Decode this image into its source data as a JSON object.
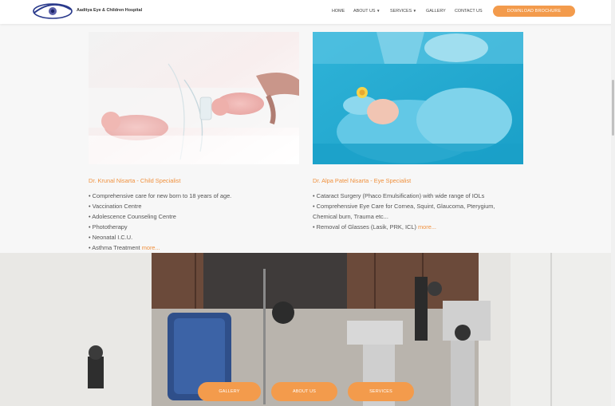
{
  "header": {
    "brand": "Aaditya Eye & Children Hospital",
    "nav": {
      "home": "HOME",
      "about": "ABOUT US",
      "services": "SERVICES",
      "gallery": "GALLERY",
      "contact": "CONTACT US"
    },
    "brochure_button": "DOWNLOAD BROCHURE"
  },
  "cards": [
    {
      "title": "Dr. Krunal Nisarta - Child Specialist",
      "items": [
        "• Comprehensive care for new born to 18 years of age.",
        "• Vaccination Centre",
        "• Adolescence Counseling Centre",
        "• Phototherapy",
        "• Neonatal I.C.U.",
        "• Asthma Treatment"
      ],
      "more": "more..."
    },
    {
      "title": "Dr. Alpa Patel Nisarta - Eye Specialist",
      "items": [
        "• Cataract Surgery  (Phaco Emulsification) with wide range of IOLs",
        "• Comprehensive Eye Care for Cornea, Squint, Glaucoma, Pterygium,",
        " Chemical burn, Trauma etc...",
        "• Removal of Glasses (Lasik, PRK, ICL)"
      ],
      "more": "more..."
    }
  ],
  "bottom_buttons": {
    "gallery": "GALLERY",
    "about": "ABOUT US",
    "services": "SERVICES"
  },
  "colors": {
    "accent": "#f39b4c",
    "link": "#f0913e",
    "text": "#555555"
  }
}
